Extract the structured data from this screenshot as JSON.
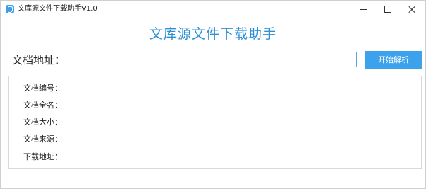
{
  "window": {
    "title": "文库源文件下载助手V1.0"
  },
  "main": {
    "heading": "文库源文件下载助手",
    "address_label": "文档地址：",
    "address_value": "",
    "parse_button": "开始解析"
  },
  "info": {
    "rows": [
      {
        "label": "文档编号：",
        "value": ""
      },
      {
        "label": "文档全名：",
        "value": ""
      },
      {
        "label": "文档大小：",
        "value": ""
      },
      {
        "label": "文档来源：",
        "value": ""
      },
      {
        "label": "下载地址：",
        "value": ""
      }
    ]
  },
  "colors": {
    "accent": "#3da2ec",
    "heading": "#2d8fd6",
    "input_border": "#5aa7e0"
  },
  "icons": {
    "app": "app-icon",
    "minimize": "minimize-icon",
    "maximize": "maximize-icon",
    "close": "close-icon"
  }
}
